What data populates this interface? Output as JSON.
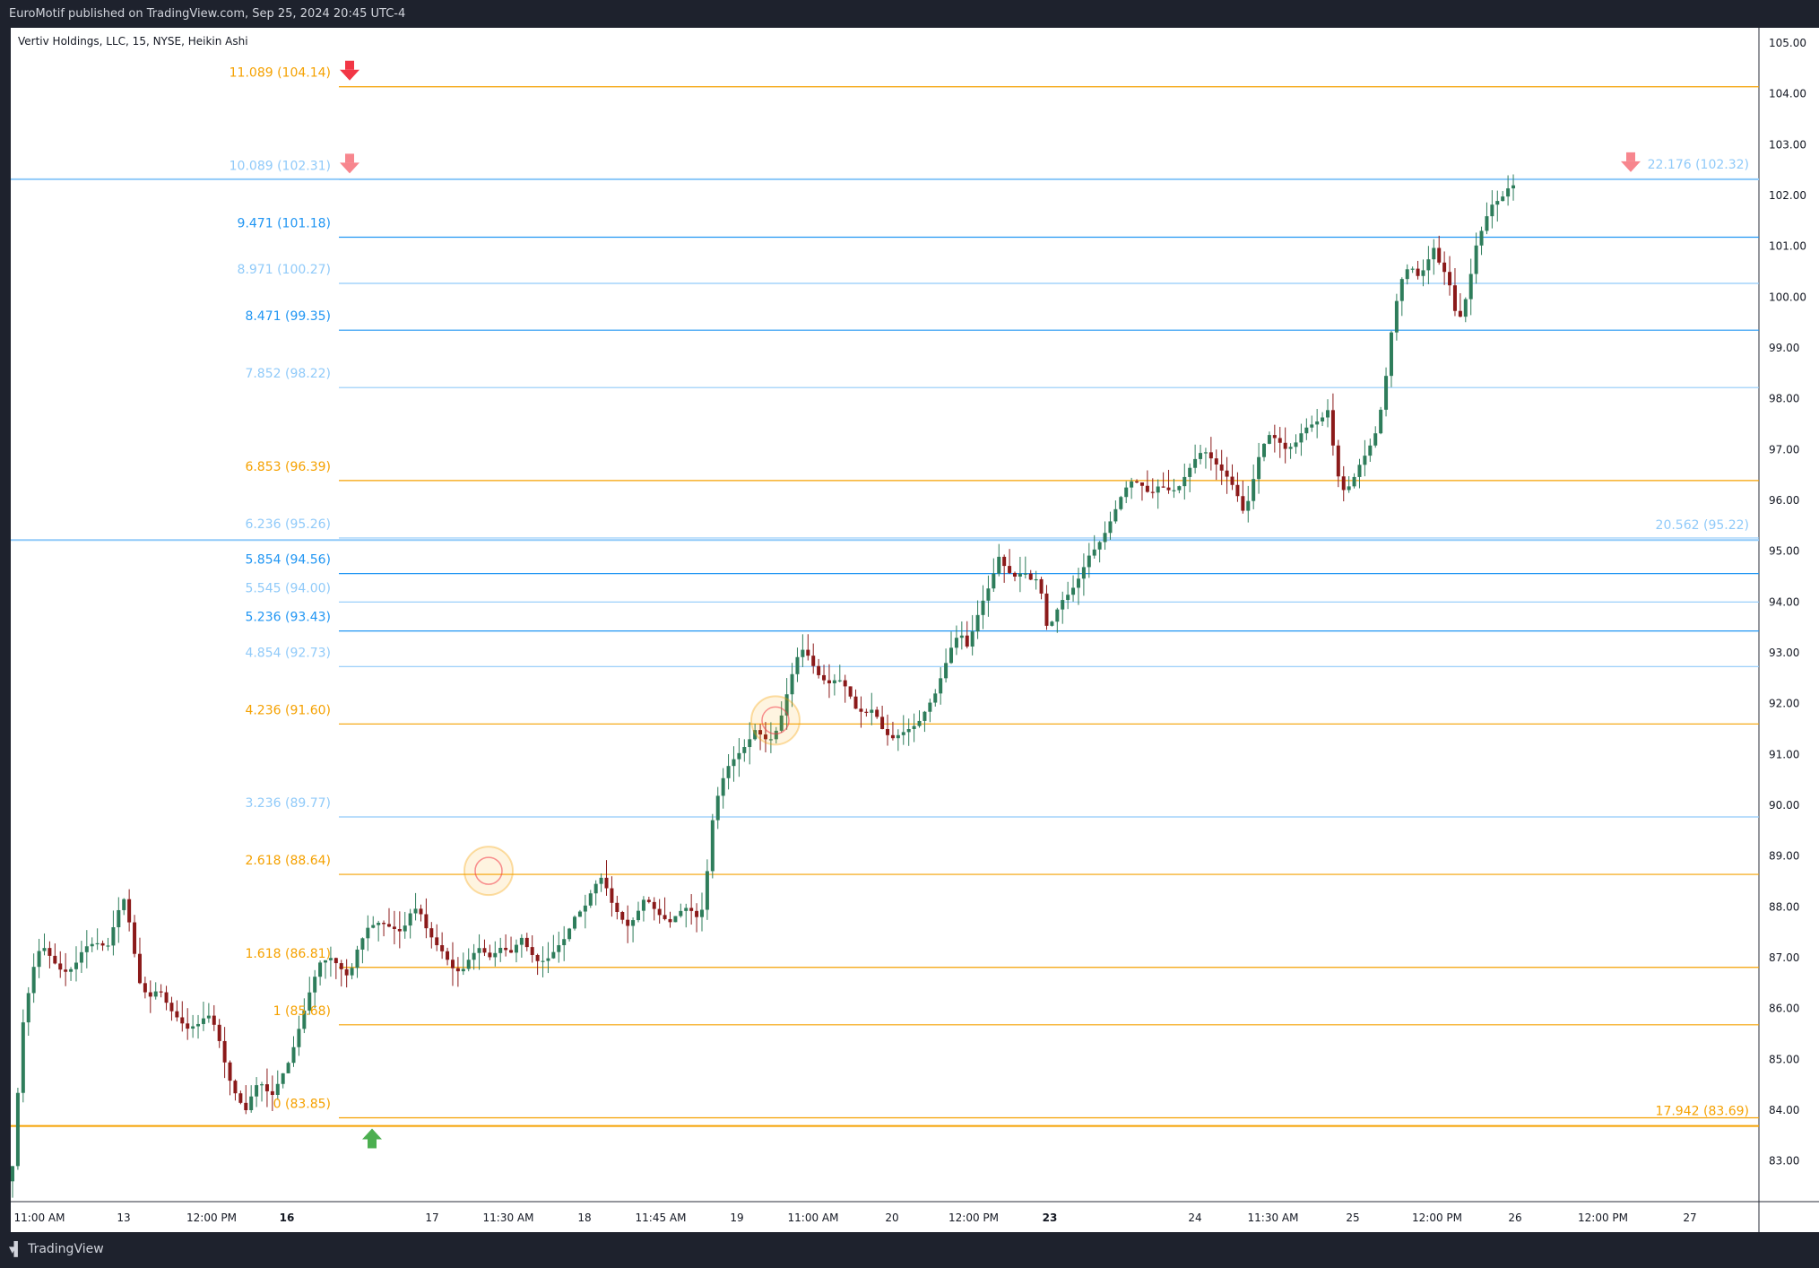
{
  "header": {
    "publisher": "EuroMotif published on TradingView.com, Sep 25, 2024 20:45 UTC-4"
  },
  "footer": {
    "brand": "TradingView"
  },
  "colors": {
    "blue": "#2196f3",
    "blue_light": "#90caf9",
    "orange": "#f5a100",
    "up_candle": "#2e7d5b",
    "down_candle": "#8b1a1a",
    "arrow_red": "#f23645",
    "arrow_pink": "#f7868e",
    "arrow_green": "#4caf50"
  },
  "chart_data": {
    "type": "candlestick",
    "title": "Vertiv Holdings, LLC, 15, NYSE, Heikin Ashi",
    "y_axis": {
      "ylim": [
        82.2,
        105.3
      ],
      "ticks": [
        "83.00",
        "84.00",
        "85.00",
        "86.00",
        "87.00",
        "88.00",
        "89.00",
        "90.00",
        "91.00",
        "92.00",
        "93.00",
        "94.00",
        "95.00",
        "96.00",
        "97.00",
        "98.00",
        "99.00",
        "100.00",
        "101.00",
        "102.00",
        "103.00",
        "104.00",
        "105.00"
      ],
      "position": "right"
    },
    "x_axis": {
      "ticks": [
        "11:00 AM",
        "13",
        "12:00 PM",
        "16",
        "17",
        "11:30 AM",
        "18",
        "11:45 AM",
        "19",
        "11:00 AM",
        "20",
        "12:00 PM",
        "23",
        "24",
        "11:30 AM",
        "25",
        "12:00 PM",
        "26",
        "12:00 PM",
        "27"
      ]
    },
    "fib_levels": [
      {
        "label": "11.089 (104.14)",
        "price": 104.14,
        "color": "orange",
        "arrow": "red-down"
      },
      {
        "label": "10.089 (102.31)",
        "price": 102.31,
        "color": "blue_light",
        "arrow": "pink-down"
      },
      {
        "label": "9.471 (101.18)",
        "price": 101.18,
        "color": "blue"
      },
      {
        "label": "8.971 (100.27)",
        "price": 100.27,
        "color": "blue_light"
      },
      {
        "label": "8.471 (99.35)",
        "price": 99.35,
        "color": "blue"
      },
      {
        "label": "7.852 (98.22)",
        "price": 98.22,
        "color": "blue_light"
      },
      {
        "label": "6.853 (96.39)",
        "price": 96.39,
        "color": "orange"
      },
      {
        "label": "6.236 (95.26)",
        "price": 95.26,
        "color": "blue_light"
      },
      {
        "label": "5.854 (94.56)",
        "price": 94.56,
        "color": "blue"
      },
      {
        "label": "5.545 (94.00)",
        "price": 94.0,
        "color": "blue_light"
      },
      {
        "label": "5.236 (93.43)",
        "price": 93.43,
        "color": "blue"
      },
      {
        "label": "4.854 (92.73)",
        "price": 92.73,
        "color": "blue_light"
      },
      {
        "label": "4.236 (91.60)",
        "price": 91.6,
        "color": "orange"
      },
      {
        "label": "3.236 (89.77)",
        "price": 89.77,
        "color": "blue_light"
      },
      {
        "label": "2.618 (88.64)",
        "price": 88.64,
        "color": "orange"
      },
      {
        "label": "1.618 (86.81)",
        "price": 86.81,
        "color": "orange"
      },
      {
        "label": "1 (85.68)",
        "price": 85.68,
        "color": "orange"
      },
      {
        "label": "0 (83.85)",
        "price": 83.85,
        "color": "orange",
        "arrow": "green-up"
      }
    ],
    "extension_levels": [
      {
        "label": "22.176 (102.32)",
        "price": 102.32,
        "color": "blue_light",
        "arrow": "pink-down"
      },
      {
        "label": "20.562 (95.22)",
        "price": 95.22,
        "color": "blue_light"
      },
      {
        "label": "17.942 (83.69)",
        "price": 83.69,
        "color": "orange"
      }
    ],
    "highlight_circles": [
      {
        "price": 88.64,
        "session": "17"
      },
      {
        "price": 91.6,
        "session": "19"
      }
    ],
    "price_path": [
      [
        0.0,
        82.6
      ],
      [
        0.2,
        82.3
      ],
      [
        0.6,
        83.8
      ],
      [
        1.0,
        85.6
      ],
      [
        1.5,
        86.4
      ],
      [
        2.0,
        87.1
      ],
      [
        2.5,
        87.2
      ],
      [
        3.2,
        86.9
      ],
      [
        3.8,
        86.7
      ],
      [
        4.5,
        86.8
      ],
      [
        5.2,
        87.2
      ],
      [
        6.0,
        87.3
      ],
      [
        6.8,
        87.2
      ],
      [
        7.5,
        87.9
      ],
      [
        8.0,
        88.2
      ],
      [
        8.5,
        87.3
      ],
      [
        9.0,
        86.5
      ],
      [
        9.6,
        86.2
      ],
      [
        10.3,
        86.4
      ],
      [
        11.0,
        86.0
      ],
      [
        11.6,
        85.8
      ],
      [
        12.2,
        85.6
      ],
      [
        13.0,
        85.7
      ],
      [
        13.6,
        85.9
      ],
      [
        14.2,
        85.6
      ],
      [
        14.7,
        85.0
      ],
      [
        15.2,
        84.5
      ],
      [
        15.7,
        84.2
      ],
      [
        16.2,
        84.0
      ],
      [
        16.6,
        84.3
      ],
      [
        17.1,
        84.6
      ],
      [
        17.5,
        84.4
      ],
      [
        18.0,
        84.3
      ],
      [
        18.5,
        84.6
      ],
      [
        19.2,
        85.0
      ],
      [
        19.8,
        85.6
      ],
      [
        20.5,
        86.3
      ],
      [
        21.2,
        86.9
      ],
      [
        22.0,
        87.0
      ],
      [
        22.6,
        86.8
      ],
      [
        23.2,
        86.6
      ],
      [
        23.8,
        87.2
      ],
      [
        24.5,
        87.6
      ],
      [
        25.3,
        87.7
      ],
      [
        26.0,
        87.6
      ],
      [
        26.8,
        87.5
      ],
      [
        27.4,
        87.9
      ],
      [
        27.9,
        88.0
      ],
      [
        28.4,
        87.6
      ],
      [
        29.0,
        87.3
      ],
      [
        29.6,
        87.1
      ],
      [
        30.2,
        86.8
      ],
      [
        30.8,
        86.7
      ],
      [
        31.4,
        87.0
      ],
      [
        32.0,
        87.2
      ],
      [
        32.8,
        87.0
      ],
      [
        33.5,
        87.2
      ],
      [
        34.2,
        87.1
      ],
      [
        34.9,
        87.4
      ],
      [
        35.5,
        87.1
      ],
      [
        36.1,
        86.9
      ],
      [
        36.8,
        87.0
      ],
      [
        37.3,
        87.2
      ],
      [
        37.9,
        87.4
      ],
      [
        38.5,
        87.8
      ],
      [
        39.2,
        88.0
      ],
      [
        39.8,
        88.4
      ],
      [
        40.4,
        88.6
      ],
      [
        41.0,
        88.1
      ],
      [
        41.6,
        87.8
      ],
      [
        42.2,
        87.6
      ],
      [
        42.8,
        87.9
      ],
      [
        43.3,
        88.2
      ],
      [
        43.8,
        88.0
      ],
      [
        44.4,
        87.8
      ],
      [
        45.0,
        87.7
      ],
      [
        45.6,
        87.9
      ],
      [
        46.2,
        88.0
      ],
      [
        46.8,
        87.8
      ],
      [
        47.3,
        88.0
      ],
      [
        47.8,
        89.6
      ],
      [
        48.4,
        90.4
      ],
      [
        49.0,
        90.8
      ],
      [
        49.6,
        91.0
      ],
      [
        50.2,
        91.2
      ],
      [
        50.8,
        91.5
      ],
      [
        51.4,
        91.3
      ],
      [
        52.0,
        91.3
      ],
      [
        52.6,
        91.8
      ],
      [
        53.1,
        92.4
      ],
      [
        53.6,
        92.9
      ],
      [
        54.1,
        93.1
      ],
      [
        54.6,
        92.8
      ],
      [
        55.2,
        92.5
      ],
      [
        55.8,
        92.4
      ],
      [
        56.4,
        92.5
      ],
      [
        57.0,
        92.3
      ],
      [
        57.6,
        91.9
      ],
      [
        58.2,
        91.8
      ],
      [
        58.8,
        91.9
      ],
      [
        59.4,
        91.5
      ],
      [
        60.0,
        91.3
      ],
      [
        60.6,
        91.4
      ],
      [
        61.2,
        91.5
      ],
      [
        61.8,
        91.6
      ],
      [
        62.4,
        91.9
      ],
      [
        63.0,
        92.2
      ],
      [
        63.6,
        92.7
      ],
      [
        64.2,
        93.2
      ],
      [
        64.7,
        93.4
      ],
      [
        65.2,
        93.1
      ],
      [
        65.7,
        93.6
      ],
      [
        66.2,
        94.0
      ],
      [
        66.8,
        94.4
      ],
      [
        67.3,
        94.9
      ],
      [
        67.9,
        94.6
      ],
      [
        68.4,
        94.5
      ],
      [
        69.0,
        94.6
      ],
      [
        69.6,
        94.4
      ],
      [
        70.1,
        94.5
      ],
      [
        70.4,
        93.5
      ],
      [
        70.9,
        93.6
      ],
      [
        71.5,
        94.0
      ],
      [
        72.2,
        94.2
      ],
      [
        72.8,
        94.5
      ],
      [
        73.4,
        94.9
      ],
      [
        74.0,
        95.1
      ],
      [
        74.6,
        95.4
      ],
      [
        75.2,
        95.8
      ],
      [
        75.8,
        96.2
      ],
      [
        76.4,
        96.4
      ],
      [
        77.0,
        96.3
      ],
      [
        77.6,
        96.1
      ],
      [
        78.2,
        96.3
      ],
      [
        78.8,
        96.2
      ],
      [
        79.4,
        96.2
      ],
      [
        80.0,
        96.5
      ],
      [
        80.6,
        96.8
      ],
      [
        81.2,
        97.0
      ],
      [
        81.8,
        96.8
      ],
      [
        82.4,
        96.6
      ],
      [
        83.0,
        96.4
      ],
      [
        83.5,
        96.1
      ],
      [
        84.0,
        95.7
      ],
      [
        84.5,
        96.3
      ],
      [
        85.0,
        96.9
      ],
      [
        85.6,
        97.3
      ],
      [
        86.2,
        97.2
      ],
      [
        86.8,
        97.0
      ],
      [
        87.4,
        97.1
      ],
      [
        88.0,
        97.4
      ],
      [
        88.6,
        97.5
      ],
      [
        89.2,
        97.6
      ],
      [
        89.7,
        97.8
      ],
      [
        90.2,
        96.6
      ],
      [
        90.7,
        96.2
      ],
      [
        91.2,
        96.3
      ],
      [
        91.8,
        96.7
      ],
      [
        92.4,
        97.0
      ],
      [
        93.0,
        97.4
      ],
      [
        93.5,
        98.2
      ],
      [
        93.9,
        99.2
      ],
      [
        94.3,
        99.9
      ],
      [
        94.8,
        100.5
      ],
      [
        95.3,
        100.6
      ],
      [
        95.8,
        100.4
      ],
      [
        96.3,
        100.6
      ],
      [
        96.8,
        101.0
      ],
      [
        97.3,
        100.6
      ],
      [
        97.8,
        100.4
      ],
      [
        98.3,
        99.7
      ],
      [
        98.7,
        99.6
      ],
      [
        99.2,
        100.2
      ],
      [
        99.7,
        101.0
      ],
      [
        100.2,
        101.4
      ],
      [
        100.7,
        101.8
      ],
      [
        101.2,
        101.9
      ],
      [
        101.6,
        102.0
      ],
      [
        102.0,
        102.2
      ]
    ]
  }
}
